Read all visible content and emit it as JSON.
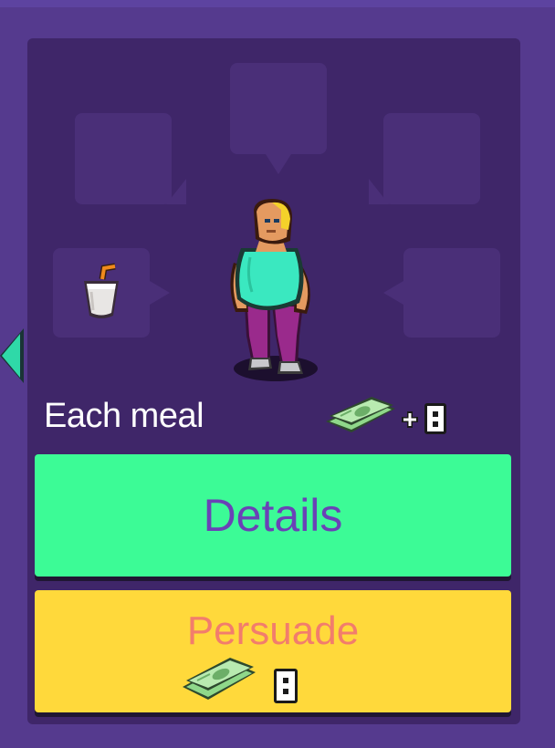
{
  "card": {
    "cost_label": "Each meal",
    "cost_icon": "money-plus-card-icon",
    "cost_card_value": "8"
  },
  "actions": {
    "details_label": "Details",
    "persuade_label": "Persuade",
    "persuade_cost_icon": "money-card-icon",
    "persuade_card_value": "8"
  },
  "thought_bubbles": [
    {
      "slot": "top",
      "item": ""
    },
    {
      "slot": "upper-left",
      "item": ""
    },
    {
      "slot": "upper-right",
      "item": ""
    },
    {
      "slot": "lower-left",
      "item": "milkshake-icon"
    },
    {
      "slot": "lower-right",
      "item": ""
    }
  ],
  "colors": {
    "background": "#553a8e",
    "panel": "#3f2669",
    "bubble": "#4a2f78",
    "details_button": "#3cfb96",
    "details_text": "#6a42b6",
    "persuade_button": "#ffd93b",
    "persuade_text": "#f27d6c",
    "nav_arrow": "#2fd9a8"
  }
}
